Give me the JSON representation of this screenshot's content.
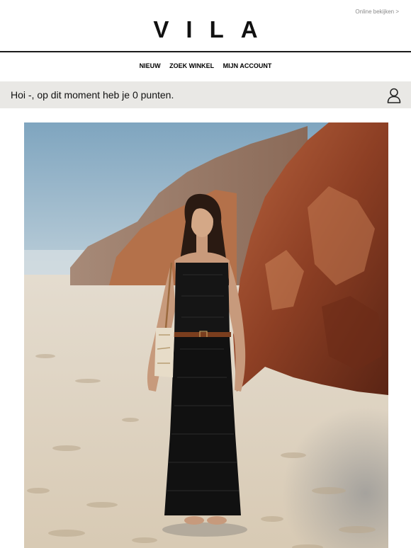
{
  "header": {
    "online_link": "Online bekijken >",
    "logo": "VILA"
  },
  "nav": {
    "items": [
      {
        "label": "NIEUW"
      },
      {
        "label": "ZOEK WINKEL"
      },
      {
        "label": "MIJN ACCOUNT"
      }
    ]
  },
  "greeting": {
    "text": "Hoi -, op dit moment heb je 0 punten.",
    "icon": "person-icon"
  },
  "hero": {
    "icon": "hero-photo"
  },
  "colors": {
    "greeting_bar": "#e9e8e5",
    "header_rule": "#1a1a1a",
    "muted_text": "#8a8a8a"
  }
}
